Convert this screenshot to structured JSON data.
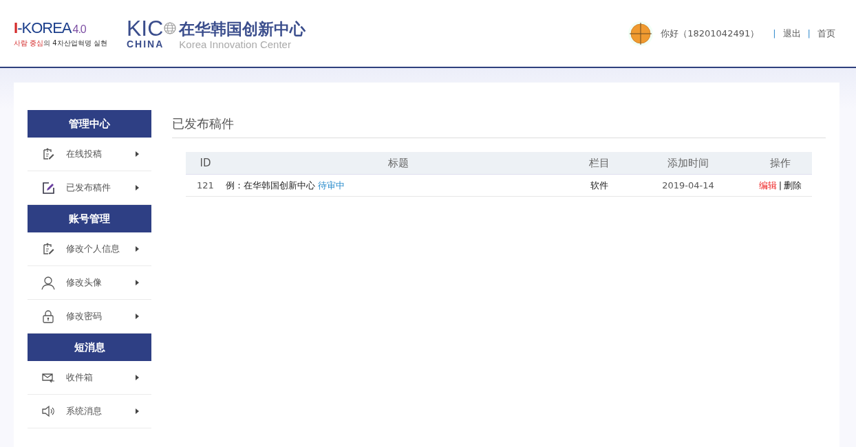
{
  "header": {
    "logo_ikorea": {
      "prefix": "I",
      "name": "-KOREA",
      "version": "4.0",
      "tagline_red": "사람 중심",
      "tagline": "의 4차산업혁명 실현"
    },
    "logo_kic": {
      "mark": "KIC",
      "mark_sub": "CHINA",
      "name_cn": "在华韩国创新中心",
      "name_en": "Korea Innovation Center"
    },
    "user": {
      "greeting": "你好（18201042491）",
      "links": [
        {
          "label": "退出"
        },
        {
          "label": "首页"
        }
      ],
      "separator": "|"
    }
  },
  "sidebar": [
    {
      "title": "管理中心",
      "items": [
        {
          "label": "在线投稿",
          "kind": "edit-doc"
        },
        {
          "label": "已发布稿件",
          "kind": "pen-square"
        }
      ]
    },
    {
      "title": "账号管理",
      "items": [
        {
          "label": "修改个人信息",
          "kind": "edit-doc"
        },
        {
          "label": "修改头像",
          "kind": "person"
        },
        {
          "label": "修改密码",
          "kind": "lock"
        }
      ]
    },
    {
      "title": "短消息",
      "items": [
        {
          "label": "收件箱",
          "kind": "mail"
        },
        {
          "label": "系统消息",
          "kind": "speaker"
        }
      ]
    }
  ],
  "content": {
    "title": "已发布稿件",
    "table": {
      "columns": [
        "ID",
        "标题",
        "栏目",
        "添加时间",
        "操作"
      ],
      "rows": [
        {
          "id": "121",
          "title": "例：在华韩国创新中心",
          "status": "待审中",
          "category": "软件",
          "date": "2019-04-14",
          "actions": [
            {
              "label": "编辑",
              "kind": "edit"
            },
            {
              "label": "删除",
              "kind": "delete"
            }
          ],
          "separator": "|"
        }
      ]
    }
  }
}
